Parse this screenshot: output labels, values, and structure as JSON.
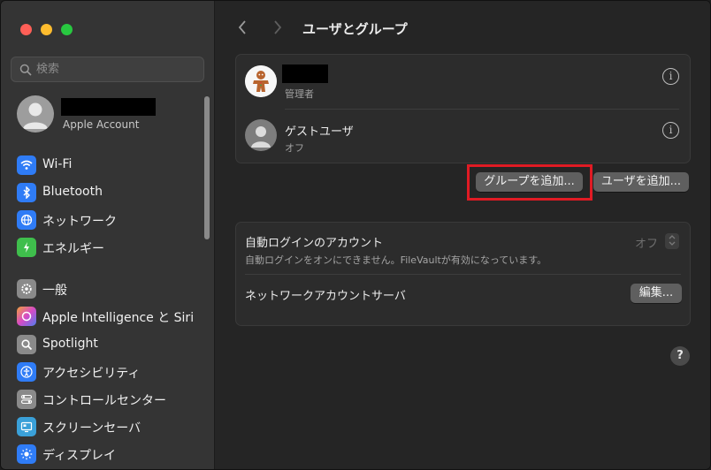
{
  "sidebar": {
    "search_placeholder": "検索",
    "account_label": "Apple Account",
    "items": [
      {
        "label": "Wi-Fi",
        "icon": "wifi-icon",
        "color": "#2f7cf6"
      },
      {
        "label": "Bluetooth",
        "icon": "bluetooth-icon",
        "color": "#2f7cf6"
      },
      {
        "label": "ネットワーク",
        "icon": "globe-icon",
        "color": "#2f7cf6"
      },
      {
        "label": "エネルギー",
        "icon": "battery-icon",
        "color": "#3fbe4c"
      },
      {
        "label": "一般",
        "icon": "gear-icon",
        "color": "#8a8a8a"
      },
      {
        "label": "Apple Intelligence と Siri",
        "icon": "siri-icon",
        "color": "#b050e0"
      },
      {
        "label": "Spotlight",
        "icon": "magnifier-icon",
        "color": "#8a8a8a"
      },
      {
        "label": "アクセシビリティ",
        "icon": "accessibility-icon",
        "color": "#2f7cf6"
      },
      {
        "label": "コントロールセンター",
        "icon": "control-center-icon",
        "color": "#8a8a8a"
      },
      {
        "label": "スクリーンセーバ",
        "icon": "screensaver-icon",
        "color": "#3aa0d8"
      },
      {
        "label": "ディスプレイ",
        "icon": "display-icon",
        "color": "#2f7cf6"
      }
    ]
  },
  "main": {
    "title": "ユーザとグループ",
    "users": [
      {
        "subtitle": "管理者"
      },
      {
        "name": "ゲストユーザ",
        "subtitle": "オフ"
      }
    ],
    "add_group_label": "グループを追加...",
    "add_user_label": "ユーザを追加...",
    "auto_login_title": "自動ログインのアカウント",
    "auto_login_desc": "自動ログインをオンにできません。FileVaultが有効になっています。",
    "auto_login_value": "オフ",
    "network_server_label": "ネットワークアカウントサーバ",
    "edit_label": "編集...",
    "help_label": "?"
  }
}
